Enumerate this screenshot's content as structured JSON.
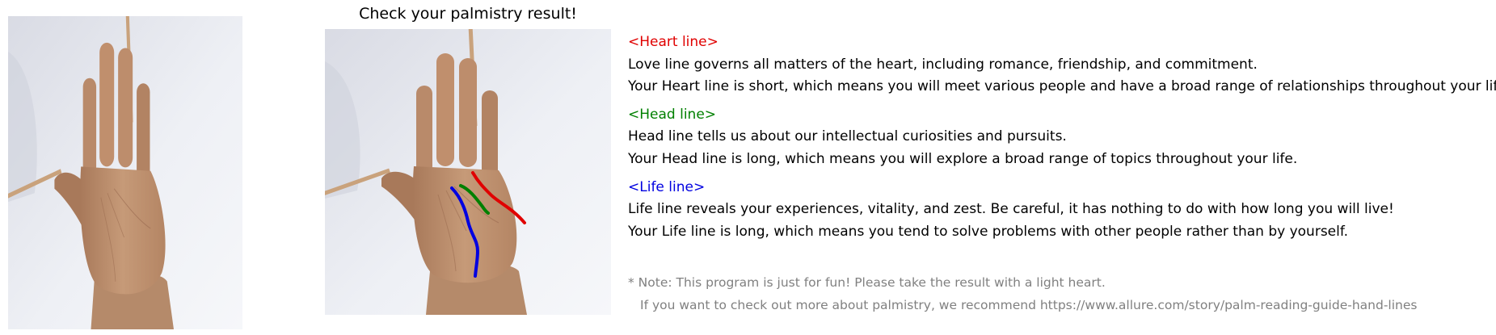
{
  "title": "Check your palmistry result!",
  "images": {
    "original": "palm-photo",
    "annotated": "palm-photo-with-lines"
  },
  "lines": {
    "heart": {
      "header": "<Heart line>",
      "color": "#e00000",
      "description": "Love line governs all matters of the heart, including romance, friendship, and commitment.",
      "result": "Your Heart line is short, which means you will meet various people and have a broad range of relationships throughout your life."
    },
    "head": {
      "header": "<Head line>",
      "color": "#008000",
      "description": "Head line tells us about our intellectual curiosities and pursuits.",
      "result": "Your Head line is long, which means you will explore a broad range of topics throughout your life."
    },
    "life": {
      "header": "<Life line>",
      "color": "#0000e0",
      "description": "Life line reveals your experiences, vitality, and zest. Be careful, it has nothing to do with how long you will live!",
      "result": "Your Life line is long, which means you tend to solve problems with other people rather than by yourself."
    }
  },
  "note": {
    "line1": "* Note: This program is just for fun! Please take the result with a light heart.",
    "line2": "If you want to check out more about palmistry, we recommend https://www.allure.com/story/palm-reading-guide-hand-lines",
    "color": "#808080"
  }
}
